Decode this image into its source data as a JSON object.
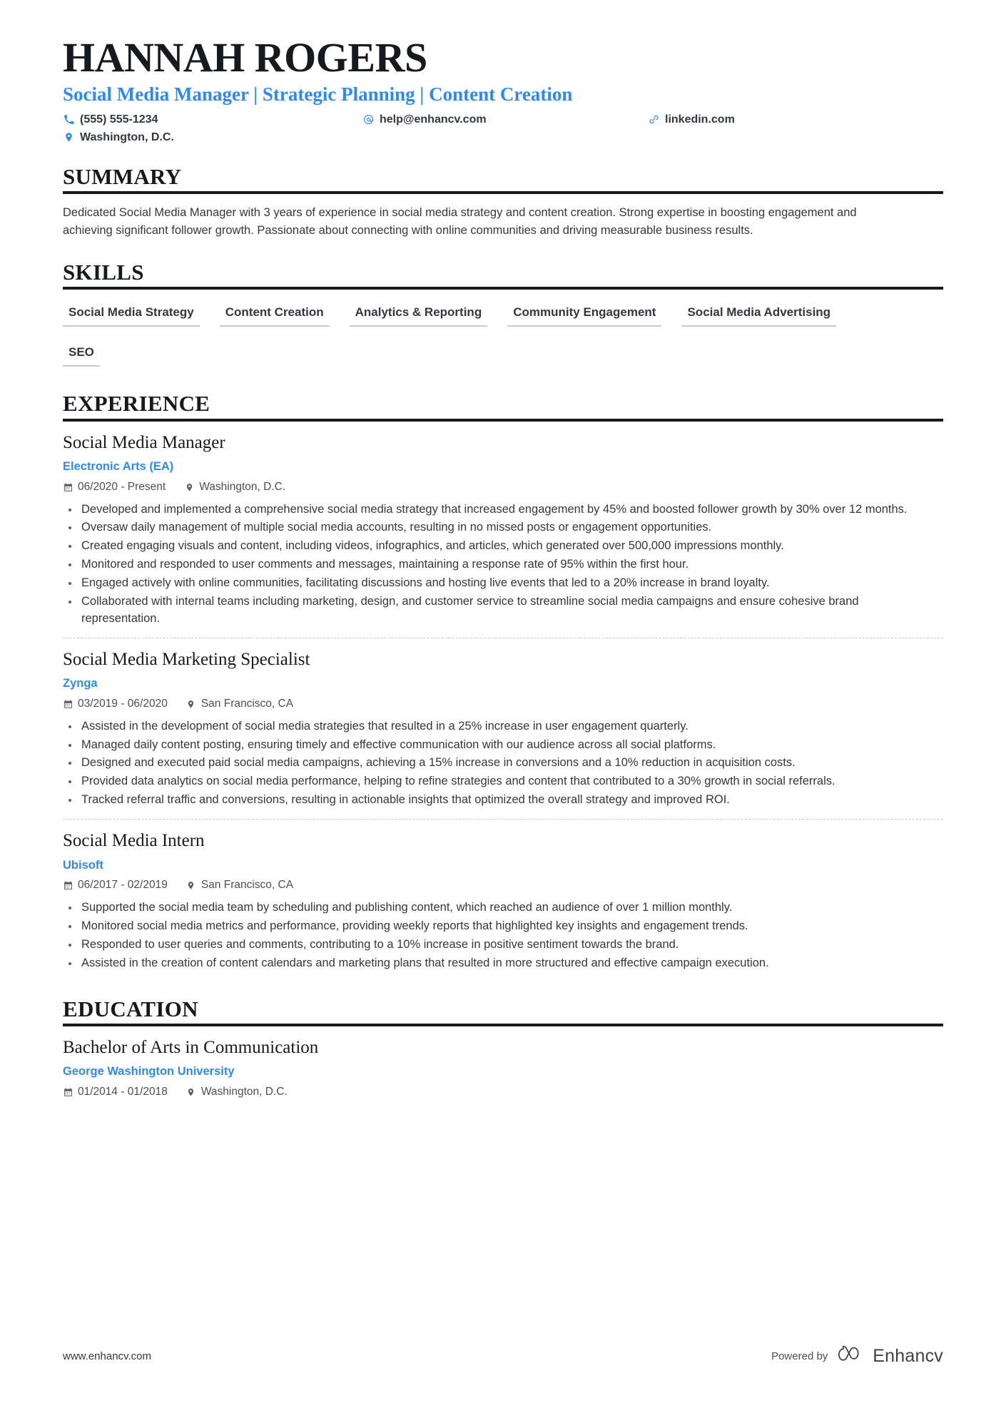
{
  "accent_color": "#2f89f5",
  "text_color": "#33383f",
  "heading_color": "#16191d",
  "header": {
    "name": "HANNAH ROGERS",
    "headline": "Social Media Manager | Strategic Planning | Content Creation",
    "contacts": [
      {
        "icon": "phone-icon",
        "text": "(555) 555-1234"
      },
      {
        "icon": "email-icon",
        "text": "help@enhancv.com"
      },
      {
        "icon": "link-icon",
        "text": "linkedin.com"
      },
      {
        "icon": "location-icon",
        "text": "Washington, D.C."
      }
    ]
  },
  "sections": {
    "summary": {
      "title": "SUMMARY",
      "text": "Dedicated Social Media Manager with 3 years of experience in social media strategy and content creation. Strong expertise in boosting engagement and achieving significant follower growth. Passionate about connecting with online communities and driving measurable business results."
    },
    "skills": {
      "title": "SKILLS",
      "items": [
        "Social Media Strategy",
        "Content Creation",
        "Analytics & Reporting",
        "Community Engagement",
        "Social Media Advertising",
        "SEO"
      ]
    },
    "experience": {
      "title": "EXPERIENCE",
      "entries": [
        {
          "role": "Social Media Manager",
          "company": "Electronic Arts (EA)",
          "dates": "06/2020 - Present",
          "location": "Washington, D.C.",
          "bullets": [
            "Developed and implemented a comprehensive social media strategy that increased engagement by 45% and boosted follower growth by 30% over 12 months.",
            "Oversaw daily management of multiple social media accounts, resulting in no missed posts or engagement opportunities.",
            "Created engaging visuals and content, including videos, infographics, and articles, which generated over 500,000 impressions monthly.",
            "Monitored and responded to user comments and messages, maintaining a response rate of 95% within the first hour.",
            "Engaged actively with online communities, facilitating discussions and hosting live events that led to a 20% increase in brand loyalty.",
            "Collaborated with internal teams including marketing, design, and customer service to streamline social media campaigns and ensure cohesive brand representation."
          ]
        },
        {
          "role": "Social Media Marketing Specialist",
          "company": "Zynga",
          "dates": "03/2019 - 06/2020",
          "location": "San Francisco, CA",
          "bullets": [
            "Assisted in the development of social media strategies that resulted in a 25% increase in user engagement quarterly.",
            "Managed daily content posting, ensuring timely and effective communication with our audience across all social platforms.",
            "Designed and executed paid social media campaigns, achieving a 15% increase in conversions and a 10% reduction in acquisition costs.",
            "Provided data analytics on social media performance, helping to refine strategies and content that contributed to a 30% growth in social referrals.",
            "Tracked referral traffic and conversions, resulting in actionable insights that optimized the overall strategy and improved ROI."
          ]
        },
        {
          "role": "Social Media Intern",
          "company": "Ubisoft",
          "dates": "06/2017 - 02/2019",
          "location": "San Francisco, CA",
          "bullets": [
            "Supported the social media team by scheduling and publishing content, which reached an audience of over 1 million monthly.",
            "Monitored social media metrics and performance, providing weekly reports that highlighted key insights and engagement trends.",
            "Responded to user queries and comments, contributing to a 10% increase in positive sentiment towards the brand.",
            "Assisted in the creation of content calendars and marketing plans that resulted in more structured and effective campaign execution."
          ]
        }
      ]
    },
    "education": {
      "title": "EDUCATION",
      "entries": [
        {
          "degree": "Bachelor of Arts in Communication",
          "school": "George Washington University",
          "dates": "01/2014 - 01/2018",
          "location": "Washington, D.C."
        }
      ]
    }
  },
  "footer": {
    "url": "www.enhancv.com",
    "powered_by": "Powered by",
    "brand": "Enhancv"
  }
}
